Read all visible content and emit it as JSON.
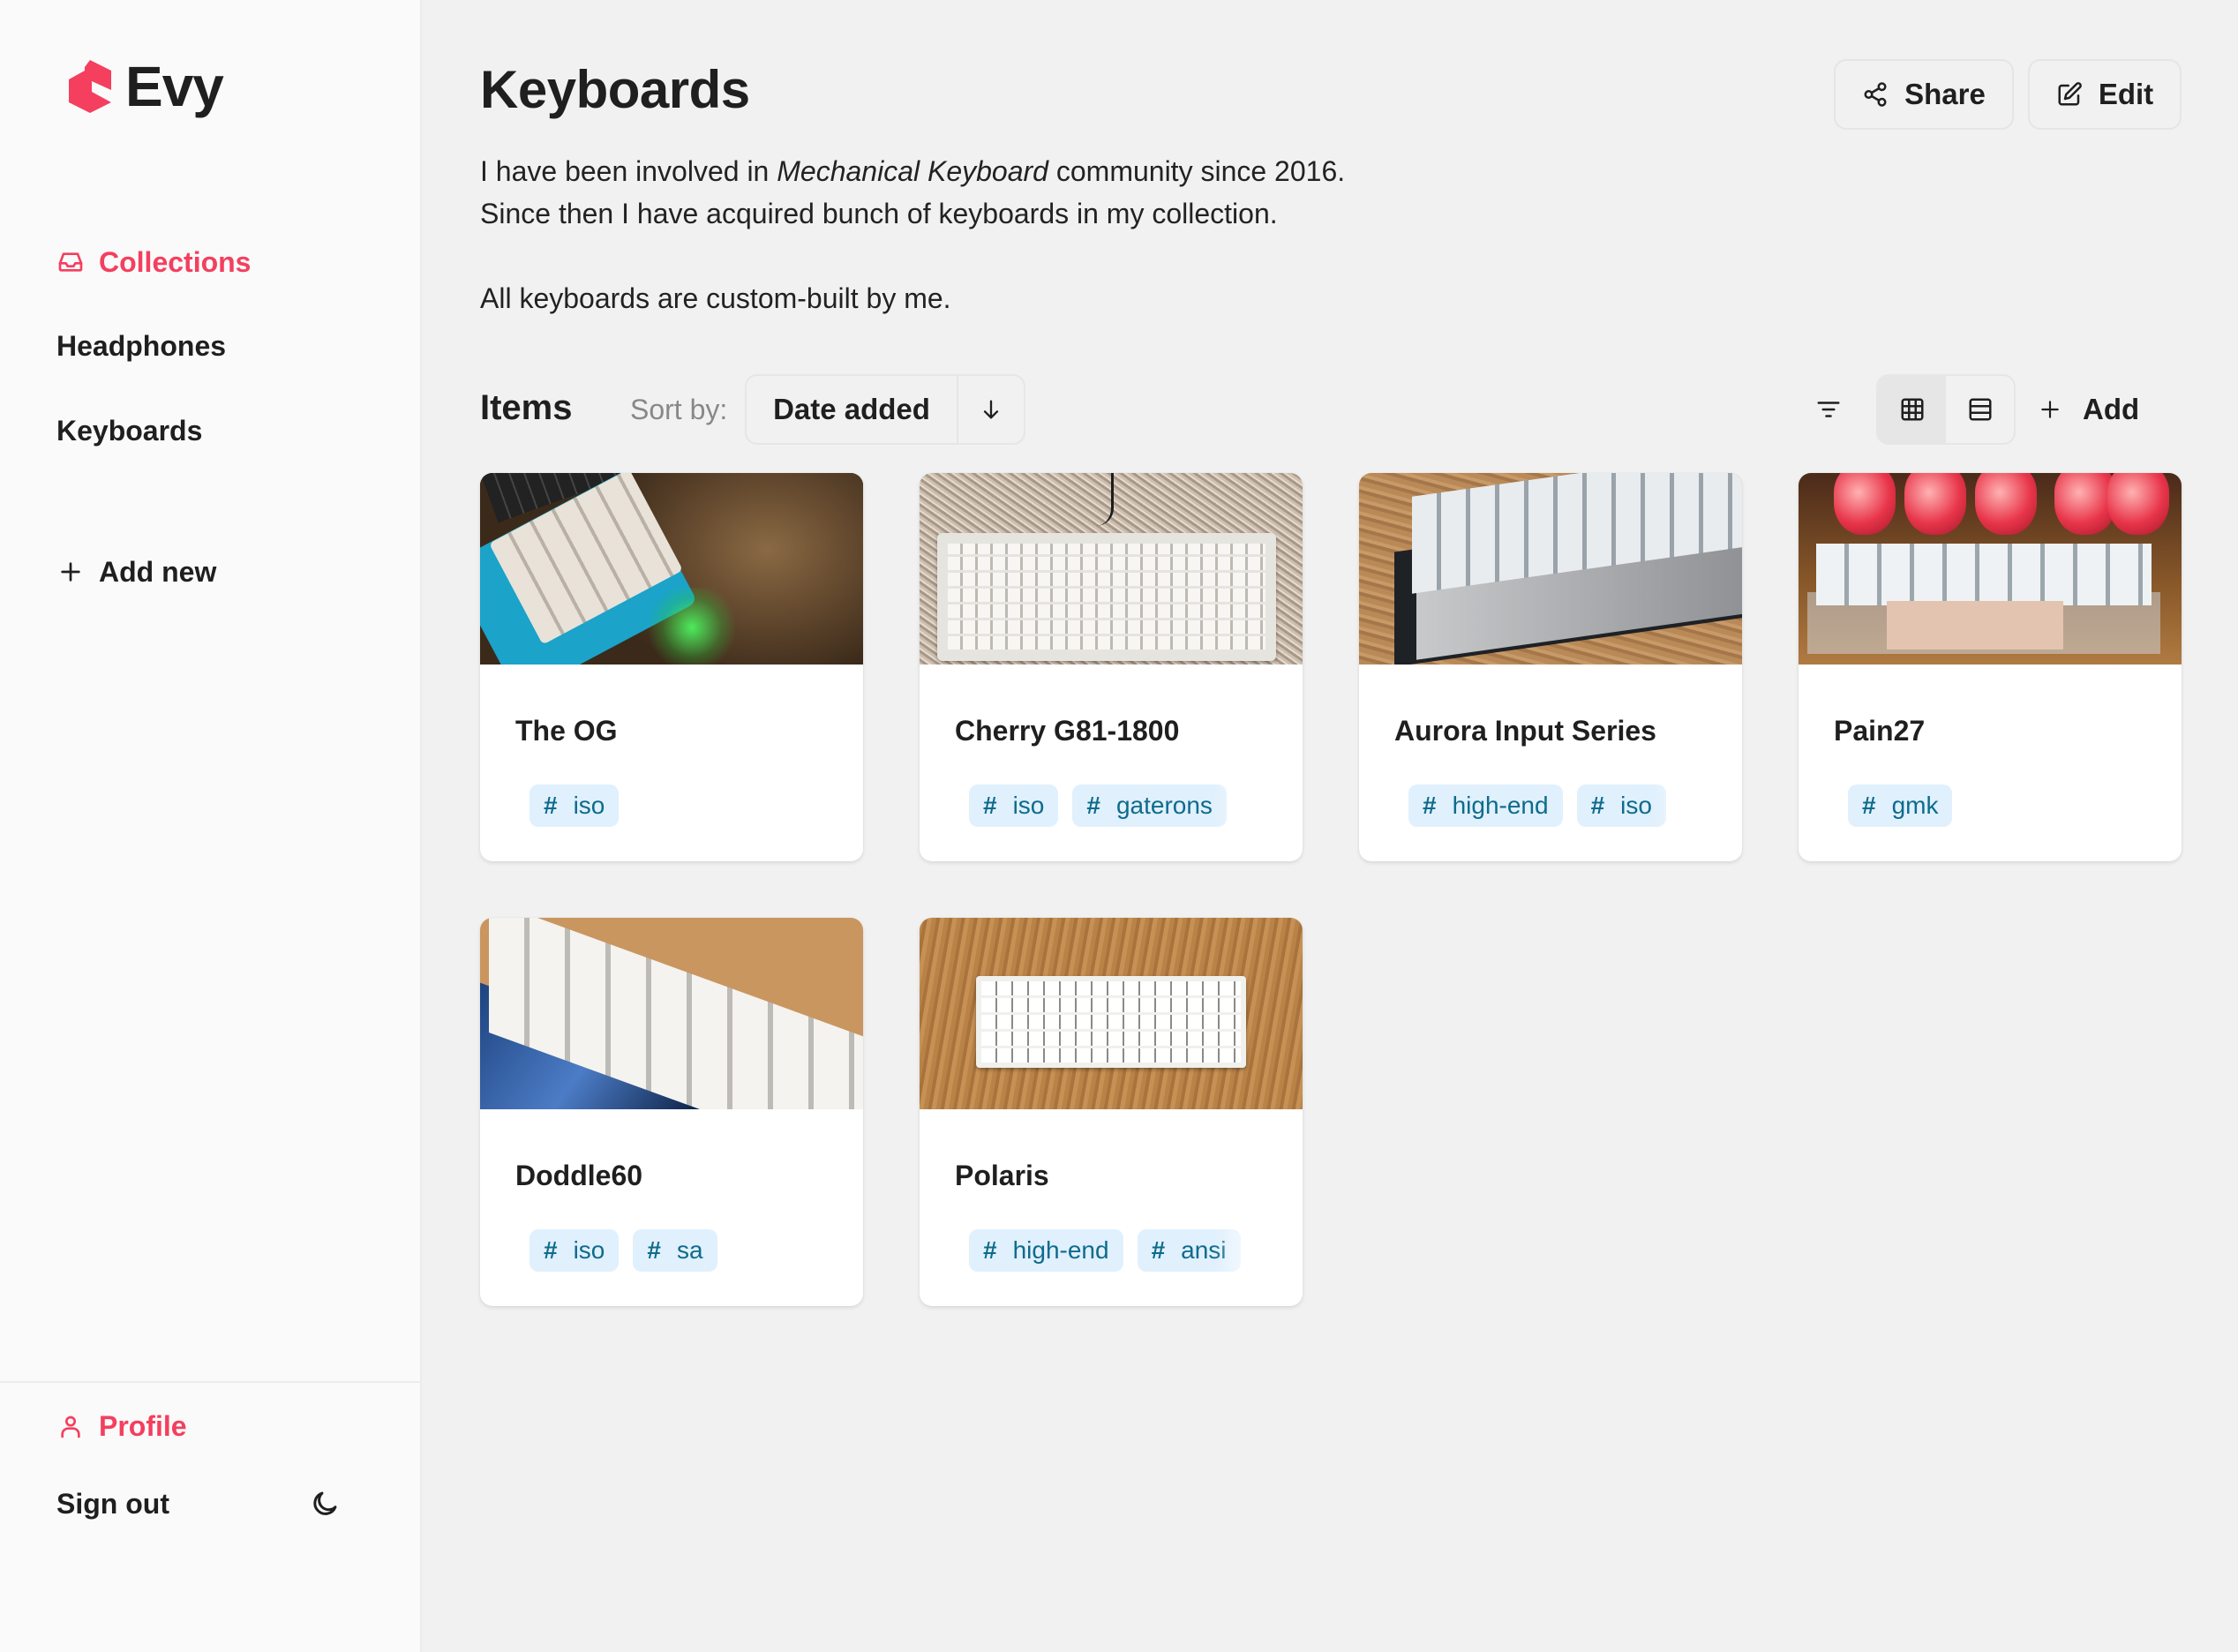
{
  "app": {
    "name": "Evy",
    "accent_color": "#f43f5e"
  },
  "sidebar": {
    "items": [
      {
        "label": "Collections",
        "icon": "inbox-icon",
        "active": true
      },
      {
        "label": "Headphones",
        "active": false
      },
      {
        "label": "Keyboards",
        "active": false
      }
    ],
    "add_new_label": "Add new",
    "profile_label": "Profile",
    "sign_out_label": "Sign out",
    "theme_icon": "moon-icon"
  },
  "header": {
    "title": "Keyboards",
    "description": {
      "line1_before": "I have been involved in ",
      "line1_emphasis": "Mechanical Keyboard",
      "line1_after": " community since 2016.",
      "line2": "Since then I have acquired bunch of keyboards in my collection.",
      "line3": "All keyboards are custom-built by me."
    },
    "share_label": "Share",
    "edit_label": "Edit"
  },
  "toolbar": {
    "items_label": "Items",
    "sort_label": "Sort by:",
    "sort_value": "Date added",
    "sort_direction": "descending",
    "view_mode": "grid",
    "add_label": "Add"
  },
  "items": [
    {
      "title": "The OG",
      "tags": [
        "iso"
      ]
    },
    {
      "title": "Cherry G81-1800",
      "tags": [
        "iso",
        "gaterons"
      ]
    },
    {
      "title": "Aurora Input Series",
      "tags": [
        "high-end",
        "iso"
      ]
    },
    {
      "title": "Pain27",
      "tags": [
        "gmk"
      ]
    },
    {
      "title": "Doddle60",
      "tags": [
        "iso",
        "sa"
      ]
    },
    {
      "title": "Polaris",
      "tags": [
        "high-end",
        "ansi"
      ]
    }
  ],
  "tag_style": {
    "background": "#e0f0fd",
    "text_color": "#0e6b8c",
    "prefix": "#"
  }
}
